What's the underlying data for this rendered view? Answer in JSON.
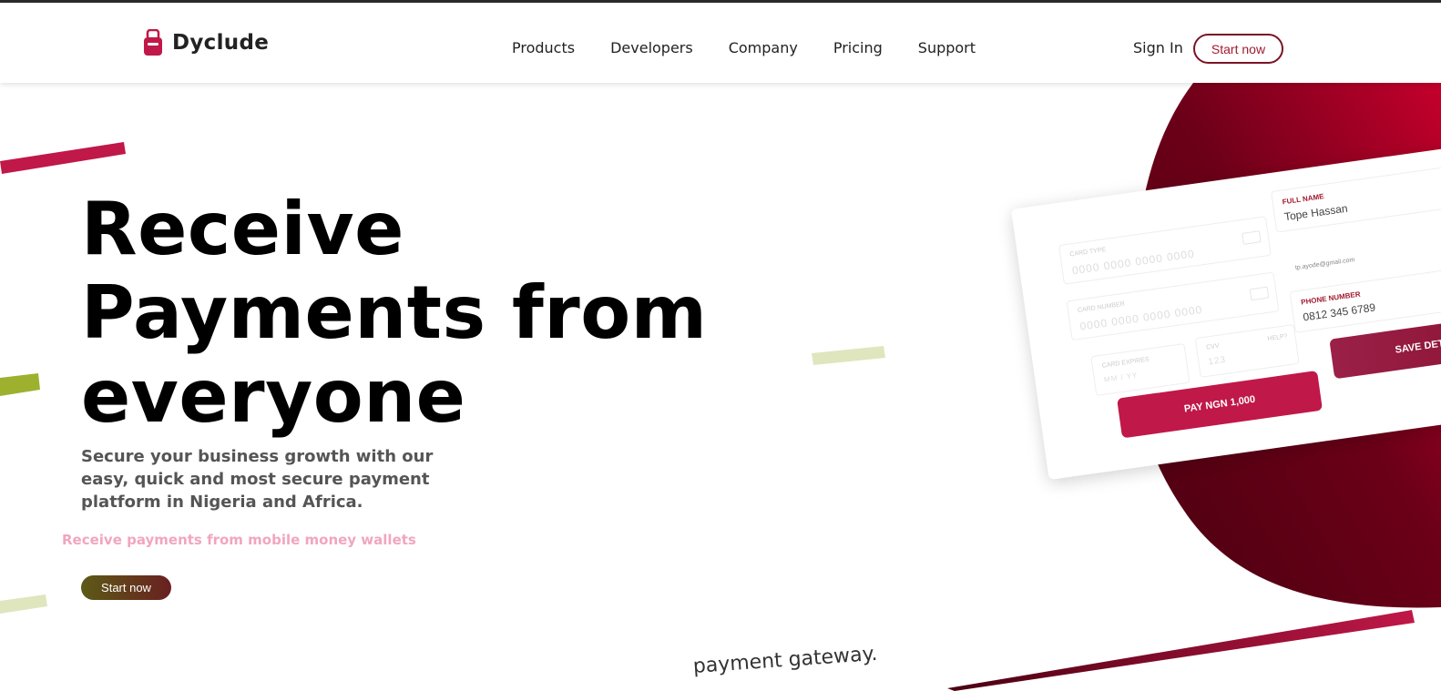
{
  "brand": {
    "name": "Dyclude",
    "color": "#c01848"
  },
  "nav": {
    "items": [
      "Products",
      "Developers",
      "Company",
      "Pricing",
      "Support"
    ],
    "sign_in": "Sign In",
    "start_now": "Start now"
  },
  "hero": {
    "title_line1": "Receive",
    "title_line2": "Payments from",
    "title_line3": "everyone",
    "subtitle": "Secure your business growth with our easy, quick and most secure payment platform in Nigeria and Africa.",
    "rotating_note": "Receive payments from mobile money wallets",
    "cta": "Start now"
  },
  "card_mockup": {
    "card_type_label": "CARD TYPE",
    "card_type_value": "0000  0000  0000  0000",
    "card_number_label": "CARD NUMBER",
    "card_number_value": "0000  0000  0000  0000",
    "card_expiry_label": "CARD EXPIRES",
    "card_expiry_placeholder": "MM / YY",
    "cvv_label": "CVV",
    "cvv_help": "HELP?",
    "cvv_placeholder": "123",
    "pay_button": "PAY NGN 1,000",
    "full_name_label": "FULL NAME",
    "full_name_value": "Tope Hassan",
    "email_value": "tp.ayode@gmail.com",
    "phone_label": "PHONE NUMBER",
    "phone_value": "0812 345 6789",
    "save_button": "SAVE DETAILS"
  },
  "footer_peek": {
    "text": "payment gateway."
  },
  "colors": {
    "accent": "#c01848",
    "deep_red": "#5a0016",
    "stripe_green": "#9db12e",
    "stripe_pale_green": "#dfe6be"
  }
}
